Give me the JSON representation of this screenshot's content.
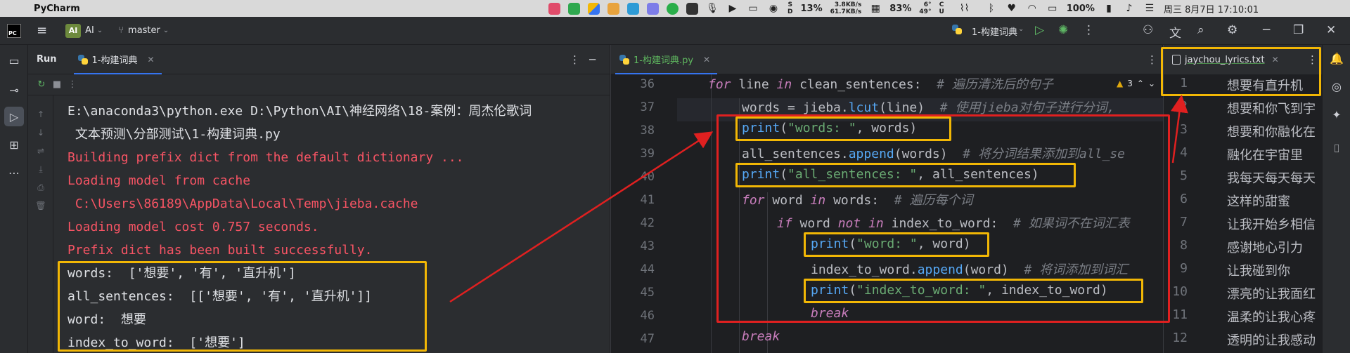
{
  "menubar": {
    "app_name": "PyCharm",
    "tray_net_up": "3.8KB/s",
    "tray_net_down": "61.7KB/s",
    "tray_cpu": "13%",
    "tray_mem": "83%",
    "tray_temp_top": "6°",
    "tray_temp_bottom": "49°",
    "tray_battery": "100%",
    "datetime": "周三 8月7日 17:10:01",
    "disk_label": "S\nD",
    "cpu_label": "C\nU"
  },
  "ide_header": {
    "project_label": "AI",
    "branch": "master",
    "run_config": "1-构建词典"
  },
  "run_panel": {
    "title": "Run",
    "tab_label": "1-构建词典",
    "console_lines": [
      {
        "text": "E:\\anaconda3\\python.exe D:\\Python\\AI\\神经网络\\18-案例：周杰伦歌词",
        "kind": "normal"
      },
      {
        "text": " 文本预测\\分部测试\\1-构建词典.py",
        "kind": "normal"
      },
      {
        "text": "Building prefix dict from the default dictionary ...",
        "kind": "err"
      },
      {
        "text": "Loading model from cache",
        "kind": "err"
      },
      {
        "text": " C:\\Users\\86189\\AppData\\Local\\Temp\\jieba.cache",
        "kind": "err"
      },
      {
        "text": "Loading model cost 0.757 seconds.",
        "kind": "err"
      },
      {
        "text": "Prefix dict has been built successfully.",
        "kind": "err"
      },
      {
        "text": "words:  ['想要', '有', '直升机']",
        "kind": "normal"
      },
      {
        "text": "all_sentences:  [['想要', '有', '直升机']]",
        "kind": "normal"
      },
      {
        "text": "word:  想要",
        "kind": "normal"
      },
      {
        "text": "index_to_word:  ['想要']",
        "kind": "normal"
      }
    ]
  },
  "editor": {
    "tab_label": "1-构建词典.py",
    "inspection_count": "3",
    "line_numbers": [
      "36",
      "37",
      "38",
      "39",
      "40",
      "41",
      "42",
      "43",
      "44",
      "45",
      "46",
      "47"
    ],
    "code": {
      "l36_for": "for",
      "l36_var": " line ",
      "l36_in": "in",
      "l36_rest": " clean_sentences:  ",
      "l36_cm": "# 遍历清洗后的句子",
      "l37_a": "words = jieba.",
      "l37_fn": "lcut",
      "l37_b": "(line)  ",
      "l37_cm": "# 使用jieba对句子进行分词,",
      "l38_print": "print",
      "l38_open": "(",
      "l38_str": "\"words: \"",
      "l38_rest": ", words)",
      "l39_a": "all_sentences.",
      "l39_fn": "append",
      "l39_b": "(words)  ",
      "l39_cm": "# 将分词结果添加到all_se",
      "l40_print": "print",
      "l40_open": "(",
      "l40_str": "\"all_sentences: \"",
      "l40_rest": ", all_sentences)",
      "l41_for": "for",
      "l41_var": " word ",
      "l41_in": "in",
      "l41_rest": " words:  ",
      "l41_cm": "# 遍历每个词",
      "l42_if": "if",
      "l42_var": " word ",
      "l42_not": "not",
      "l42_sp": " ",
      "l42_in": "in",
      "l42_rest": " index_to_word:  ",
      "l42_cm": "# 如果词不在词汇表",
      "l43_print": "print",
      "l43_open": "(",
      "l43_str": "\"word: \"",
      "l43_rest": ", word)",
      "l44_a": "index_to_word.",
      "l44_fn": "append",
      "l44_b": "(word)  ",
      "l44_cm": "# 将词添加到词汇",
      "l45_print": "print",
      "l45_open": "(",
      "l45_str": "\"index_to_word: \"",
      "l45_rest": ", index_to_word)",
      "l46_break": "break",
      "l47_break": "break"
    }
  },
  "lyrics": {
    "tab_label": "jaychou_lyrics.txt",
    "lines": [
      {
        "num": "1",
        "text": "想要有直升机"
      },
      {
        "num": "2",
        "text": "想要和你飞到宇"
      },
      {
        "num": "3",
        "text": "想要和你融化在"
      },
      {
        "num": "4",
        "text": "融化在宇宙里"
      },
      {
        "num": "5",
        "text": "我每天每天每天"
      },
      {
        "num": "6",
        "text": "这样的甜蜜"
      },
      {
        "num": "7",
        "text": "让我开始乡相信"
      },
      {
        "num": "8",
        "text": "感谢地心引力"
      },
      {
        "num": "9",
        "text": "让我碰到你"
      },
      {
        "num": "10",
        "text": "漂亮的让我面红"
      },
      {
        "num": "11",
        "text": "温柔的让我心疼"
      },
      {
        "num": "12",
        "text": "透明的让我感动"
      }
    ]
  },
  "colors": {
    "annotation_yellow": "#f2b705",
    "annotation_red": "#e02020",
    "console_error": "#f75464",
    "accent_blue": "#3574f0"
  }
}
